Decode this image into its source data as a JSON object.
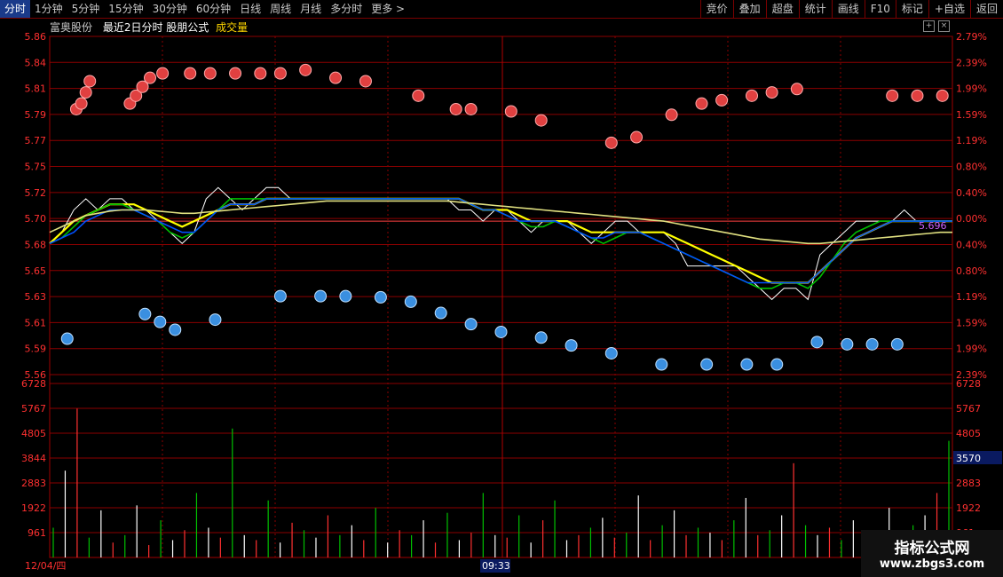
{
  "toolbar": {
    "tabs": [
      "分时",
      "1分钟",
      "5分钟",
      "15分钟",
      "30分钟",
      "60分钟",
      "日线",
      "周线",
      "月线",
      "多分时",
      "更多 >"
    ],
    "right_buttons": [
      "竞价",
      "叠加",
      "超盘",
      "统计",
      "画线",
      "F10",
      "标记",
      "+自选",
      "返回"
    ]
  },
  "header": {
    "stock": "富奥股份",
    "formula": "最近2日分时 股朋公式",
    "volume_label": "成交量"
  },
  "watermark": {
    "line1": "指标公式网",
    "line2": "www.zbgs3.com"
  },
  "chart_data": {
    "type": "line",
    "price_axis": {
      "labels": [
        "5.86",
        "5.84",
        "5.81",
        "5.79",
        "5.77",
        "5.75",
        "5.72",
        "5.70",
        "5.68",
        "5.65",
        "5.63",
        "5.61",
        "5.59",
        "5.56"
      ],
      "ylim": [
        5.555,
        5.865
      ],
      "prev_close": 5.7
    },
    "pct_axis": {
      "labels": [
        "2.79%",
        "2.39%",
        "1.99%",
        "1.59%",
        "1.19%",
        "0.80%",
        "0.40%",
        "0.00%",
        "0.40%",
        "0.80%",
        "1.19%",
        "1.59%",
        "1.99%",
        "2.39%"
      ]
    },
    "volume_axis": {
      "labels": [
        "6728",
        "5767",
        "4805",
        "3844",
        "2883",
        "1922",
        "961"
      ],
      "ylim": [
        0,
        6728
      ],
      "current": "3570"
    },
    "x_labels": {
      "start": "12/04/四",
      "cursor": "09:33"
    },
    "price_readout": "5.696",
    "series": [
      {
        "color": "#ffffff",
        "values": [
          5.68,
          5.69,
          5.71,
          5.72,
          5.71,
          5.72,
          5.72,
          5.71,
          5.71,
          5.7,
          5.69,
          5.68,
          5.69,
          5.72,
          5.73,
          5.72,
          5.71,
          5.72,
          5.73,
          5.73,
          5.72,
          5.72,
          5.72,
          5.72,
          5.72,
          5.72,
          5.72,
          5.72,
          5.72,
          5.72,
          5.72,
          5.72,
          5.72,
          5.72,
          5.71,
          5.71,
          5.7,
          5.71,
          5.71,
          5.7,
          5.69,
          5.7,
          5.7,
          5.7,
          5.69,
          5.68,
          5.69,
          5.7,
          5.7,
          5.69,
          5.69,
          5.69,
          5.68,
          5.66,
          5.66,
          5.66,
          5.66,
          5.66,
          5.65,
          5.64,
          5.63,
          5.64,
          5.64,
          5.63,
          5.67,
          5.68,
          5.69,
          5.7,
          5.7,
          5.7,
          5.7,
          5.71,
          5.7,
          5.7,
          5.7,
          5.7
        ]
      },
      {
        "color": "#ffff00",
        "values": [
          5.68,
          5.69,
          5.7,
          5.705,
          5.71,
          5.715,
          5.715,
          5.715,
          5.71,
          5.705,
          5.7,
          5.695,
          5.7,
          5.705,
          5.71,
          5.715,
          5.715,
          5.715,
          5.72,
          5.72,
          5.72,
          5.72,
          5.72,
          5.72,
          5.72,
          5.72,
          5.72,
          5.72,
          5.72,
          5.72,
          5.72,
          5.72,
          5.72,
          5.72,
          5.72,
          5.715,
          5.71,
          5.71,
          5.71,
          5.705,
          5.7,
          5.7,
          5.7,
          5.7,
          5.695,
          5.69,
          5.69,
          5.69,
          5.69,
          5.69,
          5.69,
          5.69,
          5.685,
          5.68,
          5.675,
          5.67,
          5.665,
          5.66,
          5.655,
          5.65,
          5.645,
          5.645,
          5.645,
          5.645,
          5.655,
          5.665,
          5.675,
          5.685,
          5.69,
          5.695,
          5.7,
          5.7,
          5.7,
          5.7,
          5.7,
          5.7
        ]
      },
      {
        "color": "#00c000",
        "values": [
          5.68,
          5.685,
          5.695,
          5.705,
          5.71,
          5.715,
          5.715,
          5.71,
          5.705,
          5.7,
          5.69,
          5.685,
          5.69,
          5.7,
          5.71,
          5.72,
          5.72,
          5.72,
          5.72,
          5.72,
          5.72,
          5.72,
          5.72,
          5.72,
          5.72,
          5.72,
          5.72,
          5.72,
          5.72,
          5.72,
          5.72,
          5.72,
          5.72,
          5.72,
          5.72,
          5.715,
          5.71,
          5.71,
          5.705,
          5.7,
          5.695,
          5.695,
          5.7,
          5.695,
          5.69,
          5.685,
          5.68,
          5.685,
          5.69,
          5.69,
          5.685,
          5.68,
          5.675,
          5.67,
          5.665,
          5.66,
          5.655,
          5.65,
          5.645,
          5.64,
          5.64,
          5.645,
          5.645,
          5.64,
          5.65,
          5.665,
          5.68,
          5.69,
          5.695,
          5.7,
          5.7,
          5.7,
          5.7,
          5.7,
          5.7,
          5.7
        ]
      },
      {
        "color": "#0050ff",
        "values": [
          5.68,
          5.685,
          5.69,
          5.7,
          5.705,
          5.71,
          5.71,
          5.71,
          5.705,
          5.7,
          5.695,
          5.69,
          5.69,
          5.7,
          5.71,
          5.715,
          5.715,
          5.715,
          5.72,
          5.72,
          5.72,
          5.72,
          5.72,
          5.72,
          5.72,
          5.72,
          5.72,
          5.72,
          5.72,
          5.72,
          5.72,
          5.72,
          5.72,
          5.72,
          5.72,
          5.715,
          5.71,
          5.71,
          5.705,
          5.7,
          5.7,
          5.7,
          5.7,
          5.695,
          5.69,
          5.685,
          5.685,
          5.69,
          5.69,
          5.69,
          5.685,
          5.68,
          5.675,
          5.67,
          5.665,
          5.66,
          5.655,
          5.65,
          5.645,
          5.645,
          5.645,
          5.645,
          5.645,
          5.645,
          5.655,
          5.665,
          5.675,
          5.685,
          5.69,
          5.695,
          5.7,
          5.7,
          5.7,
          5.7,
          5.7,
          5.7
        ]
      },
      {
        "color": "#e0e080",
        "values": [
          5.69,
          5.695,
          5.7,
          5.705,
          5.707,
          5.709,
          5.71,
          5.71,
          5.71,
          5.709,
          5.708,
          5.707,
          5.707,
          5.708,
          5.709,
          5.71,
          5.711,
          5.712,
          5.713,
          5.714,
          5.715,
          5.716,
          5.717,
          5.718,
          5.718,
          5.718,
          5.718,
          5.718,
          5.718,
          5.718,
          5.718,
          5.718,
          5.718,
          5.718,
          5.717,
          5.716,
          5.715,
          5.714,
          5.713,
          5.712,
          5.711,
          5.71,
          5.709,
          5.708,
          5.707,
          5.706,
          5.705,
          5.704,
          5.703,
          5.702,
          5.701,
          5.7,
          5.698,
          5.696,
          5.694,
          5.692,
          5.69,
          5.688,
          5.686,
          5.684,
          5.683,
          5.682,
          5.681,
          5.68,
          5.68,
          5.681,
          5.682,
          5.683,
          5.684,
          5.685,
          5.686,
          5.687,
          5.688,
          5.689,
          5.69,
          5.69
        ]
      }
    ],
    "up_markers": [
      [
        0.53,
        5.8
      ],
      [
        0.63,
        5.805
      ],
      [
        0.72,
        5.815
      ],
      [
        0.8,
        5.825
      ],
      [
        1.6,
        5.805
      ],
      [
        1.72,
        5.812
      ],
      [
        1.85,
        5.82
      ],
      [
        2.0,
        5.828
      ],
      [
        2.25,
        5.832
      ],
      [
        2.8,
        5.832
      ],
      [
        3.2,
        5.832
      ],
      [
        3.7,
        5.832
      ],
      [
        4.2,
        5.832
      ],
      [
        4.6,
        5.832
      ],
      [
        5.1,
        5.835
      ],
      [
        5.7,
        5.828
      ],
      [
        6.3,
        5.825
      ],
      [
        7.35,
        5.812
      ],
      [
        8.1,
        5.8
      ],
      [
        8.4,
        5.8
      ],
      [
        9.2,
        5.798
      ],
      [
        9.8,
        5.79
      ],
      [
        11.2,
        5.77
      ],
      [
        11.7,
        5.775
      ],
      [
        12.4,
        5.795
      ],
      [
        13.0,
        5.805
      ],
      [
        13.4,
        5.808
      ],
      [
        14.0,
        5.812
      ],
      [
        14.4,
        5.815
      ],
      [
        14.9,
        5.818
      ],
      [
        16.8,
        5.812
      ],
      [
        17.3,
        5.812
      ],
      [
        17.8,
        5.812
      ]
    ],
    "down_markers": [
      [
        0.35,
        5.595
      ],
      [
        1.9,
        5.617
      ],
      [
        2.2,
        5.61
      ],
      [
        2.5,
        5.603
      ],
      [
        3.3,
        5.612
      ],
      [
        4.6,
        5.633
      ],
      [
        5.4,
        5.633
      ],
      [
        5.9,
        5.633
      ],
      [
        6.6,
        5.632
      ],
      [
        7.2,
        5.628
      ],
      [
        7.8,
        5.618
      ],
      [
        8.4,
        5.608
      ],
      [
        9.0,
        5.601
      ],
      [
        9.8,
        5.596
      ],
      [
        10.4,
        5.589
      ],
      [
        11.2,
        5.582
      ],
      [
        12.2,
        5.572
      ],
      [
        13.1,
        5.572
      ],
      [
        13.9,
        5.572
      ],
      [
        14.5,
        5.572
      ],
      [
        15.3,
        5.592
      ],
      [
        15.9,
        5.59
      ],
      [
        16.4,
        5.59
      ],
      [
        16.9,
        5.59
      ]
    ],
    "volume": [
      1200,
      3500,
      6000,
      800,
      1900,
      600,
      900,
      2100,
      500,
      1500,
      700,
      1100,
      2600,
      1200,
      800,
      5200,
      900,
      700,
      2300,
      600,
      1400,
      1100,
      800,
      1700,
      900,
      1300,
      700,
      2000,
      600,
      1100,
      900,
      1500,
      600,
      1800,
      700,
      1000,
      2600,
      900,
      800,
      1700,
      600,
      1500,
      2300,
      700,
      900,
      1200,
      1600,
      800,
      1000,
      2500,
      700,
      1300,
      1900,
      900,
      1200,
      1000,
      700,
      1500,
      2400,
      900,
      1100,
      1700,
      3800,
      1300,
      900,
      1200,
      700,
      1500,
      1100,
      800,
      2000,
      900,
      1300,
      1700,
      2600,
      4700
    ]
  }
}
